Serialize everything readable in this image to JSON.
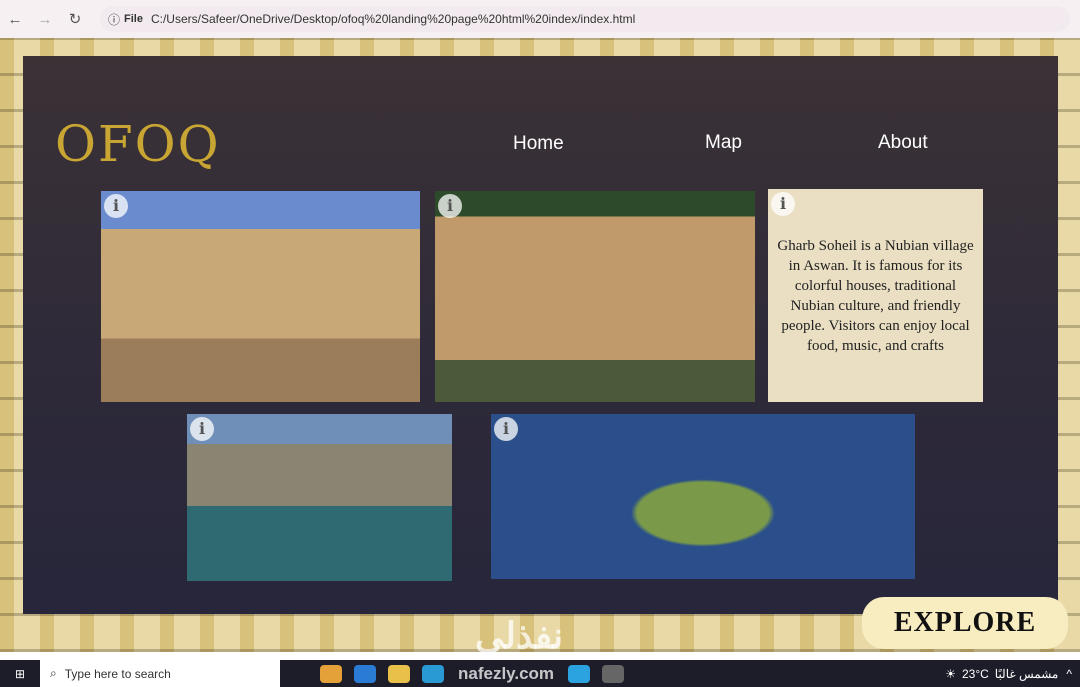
{
  "browser": {
    "file_label": "File",
    "url": "C:/Users/Safeer/OneDrive/Desktop/ofoq%20landing%20page%20html%20index/index.html"
  },
  "site": {
    "logo": "OFOQ",
    "nav": [
      "Home",
      "Map",
      "About"
    ],
    "cards": [
      {
        "info": "i",
        "image": "philae-temple"
      },
      {
        "info": "i",
        "image": "nubian-museum"
      },
      {
        "info": "i",
        "description": "Gharb Soheil is a Nubian village in Aswan. It is famous for its colorful houses, traditional Nubian culture, and friendly people. Visitors can enjoy local food, music, and crafts"
      },
      {
        "info": "i",
        "image": "aswan-high-dam"
      },
      {
        "info": "i",
        "image": "philae-island"
      }
    ],
    "explore": "EXPLORE"
  },
  "taskbar": {
    "search_placeholder": "Type here to search",
    "weather": "23°C",
    "weather_text": "مشمس غالبًا"
  },
  "watermark": {
    "arabic": "نفذلي",
    "latin": "nafezly.com"
  }
}
